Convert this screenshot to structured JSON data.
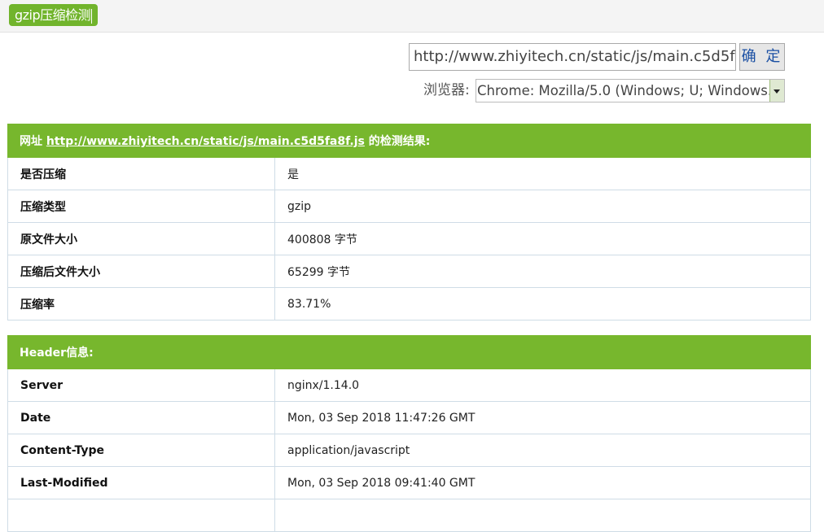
{
  "top": {
    "tag_label": "gzip压缩检测"
  },
  "form": {
    "url_value": "http://www.zhiyitech.cn/static/js/main.c5d5f",
    "ok_label": "确 定",
    "browser_label": "浏览器:",
    "browser_value": "Chrome: Mozilla/5.0 (Windows; U; Windows..."
  },
  "result": {
    "prefix": "网址",
    "url": "http://www.zhiyitech.cn/static/js/main.c5d5fa8f.js",
    "suffix": "的检测结果:",
    "rows": [
      {
        "key": "是否压缩",
        "value": "是"
      },
      {
        "key": "压缩类型",
        "value": "gzip"
      },
      {
        "key": "原文件大小",
        "value": "400808 字节"
      },
      {
        "key": "压缩后文件大小",
        "value": "65299 字节"
      },
      {
        "key": "压缩率",
        "value": "83.71%"
      }
    ]
  },
  "header": {
    "title": "Header信息:",
    "rows": [
      {
        "key": "Server",
        "value": "nginx/1.14.0"
      },
      {
        "key": "Date",
        "value": "Mon, 03 Sep 2018 11:47:26 GMT"
      },
      {
        "key": "Content-Type",
        "value": "application/javascript"
      },
      {
        "key": "Last-Modified",
        "value": "Mon, 03 Sep 2018 09:41:40 GMT"
      },
      {
        "key": "",
        "value": ""
      }
    ]
  },
  "colors": {
    "accent": "#77b72d",
    "border": "#cfdce6",
    "link": "#1a4fa3"
  }
}
